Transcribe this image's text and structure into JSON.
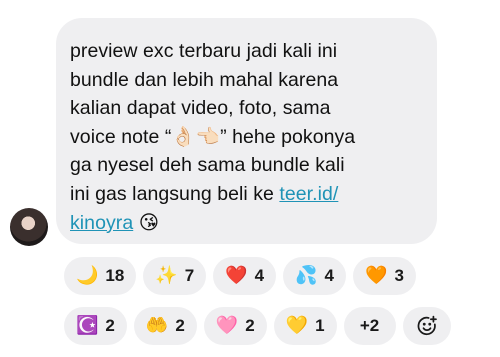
{
  "message": {
    "text": "preview exc terbaru jadi kali ini\nbundle dan lebih mahal karena\nkalian dapat video, foto, sama\nvoice note “👌🏻👈🏻” hehe pokonya\nga nyesel deh sama bundle kali\nini gas langsung beli ke ",
    "link_text_line1": "teer.id/",
    "link_text_line2": "kinoyra",
    "trailing_emoji": "😘"
  },
  "reactions": {
    "row1": [
      {
        "emoji": "🌙",
        "count": "18"
      },
      {
        "emoji": "✨",
        "count": "7"
      },
      {
        "emoji": "❤️",
        "count": "4"
      },
      {
        "emoji": "💦",
        "count": "4"
      },
      {
        "emoji": "🧡",
        "count": "3"
      }
    ],
    "row2": [
      {
        "emoji": "☪️",
        "count": "2"
      },
      {
        "emoji": "🤲",
        "count": "2"
      },
      {
        "emoji": "🩷",
        "count": "2"
      },
      {
        "emoji": "💛",
        "count": "1"
      }
    ],
    "more_label": "+2",
    "add_reaction_icon": "smiley-plus-icon"
  },
  "colors": {
    "bubble_bg": "#efeff1",
    "link": "#1f93b6",
    "chip_bg": "#efeff1"
  }
}
